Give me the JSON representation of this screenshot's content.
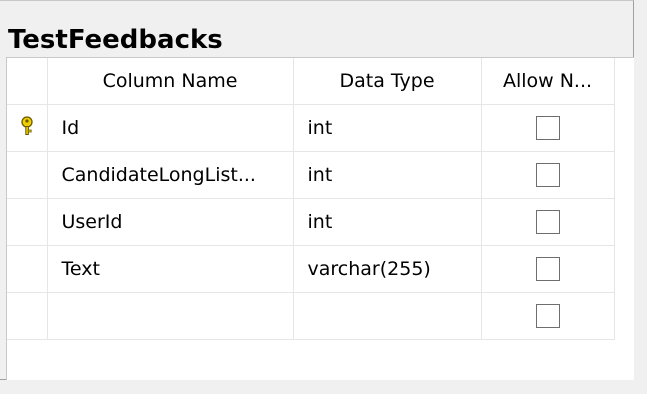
{
  "table_title": "TestFeedbacks",
  "headers": {
    "column_name": "Column Name",
    "data_type": "Data Type",
    "allow_nulls": "Allow N..."
  },
  "rows": [
    {
      "name": "Id",
      "type": "int",
      "allow_nulls": false,
      "primary_key": true
    },
    {
      "name": "CandidateLongList...",
      "type": "int",
      "allow_nulls": false,
      "primary_key": false
    },
    {
      "name": "UserId",
      "type": "int",
      "allow_nulls": false,
      "primary_key": false
    },
    {
      "name": "Text",
      "type": "varchar(255)",
      "allow_nulls": false,
      "primary_key": false
    },
    {
      "name": "",
      "type": "",
      "allow_nulls": false,
      "primary_key": false
    }
  ],
  "icons": {
    "primary_key": "key-icon"
  },
  "colors": {
    "key": "#e0c000",
    "grid_line": "#e6e6e6"
  }
}
